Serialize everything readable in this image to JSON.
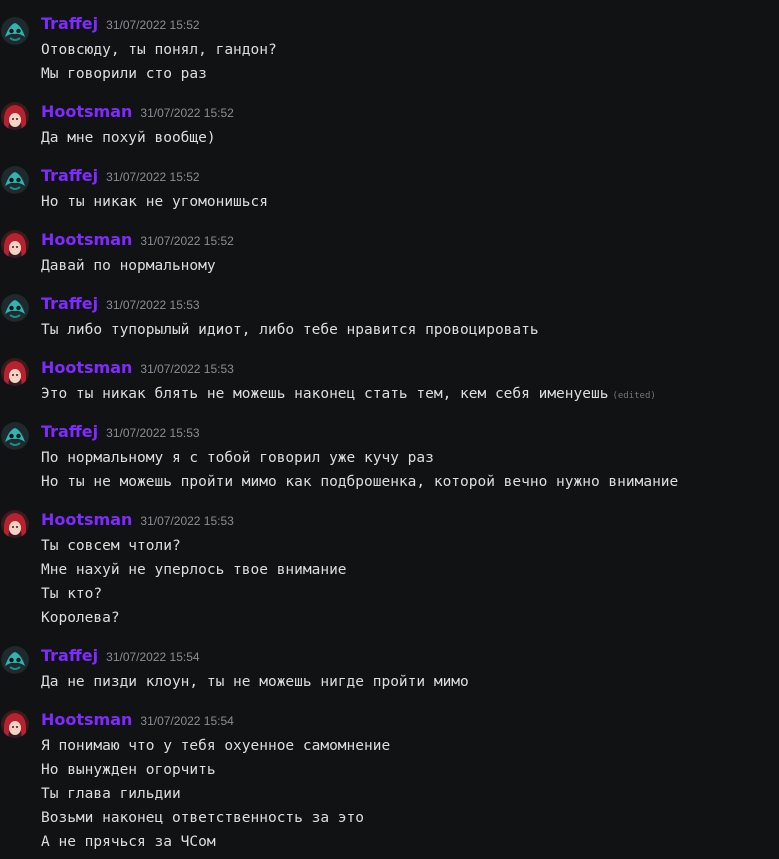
{
  "colors": {
    "background": "#111214",
    "username": "#7f2bff",
    "message_text": "#dcddde",
    "timestamp": "#8a8e94",
    "edited": "#72767d"
  },
  "messages": [
    {
      "author": "Traffej",
      "avatar_icon": "teal-character-avatar-icon",
      "timestamp": "31/07/2022 15:52",
      "lines": [
        "Отовсюду, ты понял, гандон?",
        "Мы говорили сто раз"
      ]
    },
    {
      "author": "Hootsman",
      "avatar_icon": "red-haired-character-avatar-icon",
      "timestamp": "31/07/2022 15:52",
      "lines": [
        "Да мне похуй вообще)"
      ]
    },
    {
      "author": "Traffej",
      "avatar_icon": "teal-character-avatar-icon",
      "timestamp": "31/07/2022 15:52",
      "lines": [
        "Но ты никак не угомонишься"
      ]
    },
    {
      "author": "Hootsman",
      "avatar_icon": "red-haired-character-avatar-icon",
      "timestamp": "31/07/2022 15:52",
      "lines": [
        "Давай по нормальному"
      ]
    },
    {
      "author": "Traffej",
      "avatar_icon": "teal-character-avatar-icon",
      "timestamp": "31/07/2022 15:53",
      "lines": [
        "Ты либо тупорылый идиот, либо тебе нравится провоцировать"
      ]
    },
    {
      "author": "Hootsman",
      "avatar_icon": "red-haired-character-avatar-icon",
      "timestamp": "31/07/2022 15:53",
      "lines": [
        "Это ты никак блять не можешь наконец стать тем, кем себя именуешь"
      ],
      "edited_label": "(edited)"
    },
    {
      "author": "Traffej",
      "avatar_icon": "teal-character-avatar-icon",
      "timestamp": "31/07/2022 15:53",
      "lines": [
        "По нормальному я с тобой говорил уже кучу раз",
        "Но ты не можешь пройти мимо как подброшенка, которой вечно нужно внимание"
      ]
    },
    {
      "author": "Hootsman",
      "avatar_icon": "red-haired-character-avatar-icon",
      "timestamp": "31/07/2022 15:53",
      "lines": [
        "Ты совсем чтоли?",
        "Мне нахуй не уперлось твое внимание",
        "Ты кто?",
        "Королева?"
      ]
    },
    {
      "author": "Traffej",
      "avatar_icon": "teal-character-avatar-icon",
      "timestamp": "31/07/2022 15:54",
      "lines": [
        "Да не пизди клоун, ты не можешь нигде пройти мимо"
      ]
    },
    {
      "author": "Hootsman",
      "avatar_icon": "red-haired-character-avatar-icon",
      "timestamp": "31/07/2022 15:54",
      "lines": [
        "Я понимаю что у тебя охуенное самомнение",
        "Но вынужден огорчить",
        "Ты глава гильдии",
        "Возьми наконец ответственность за это",
        "А не прячься за ЧСом"
      ]
    }
  ]
}
